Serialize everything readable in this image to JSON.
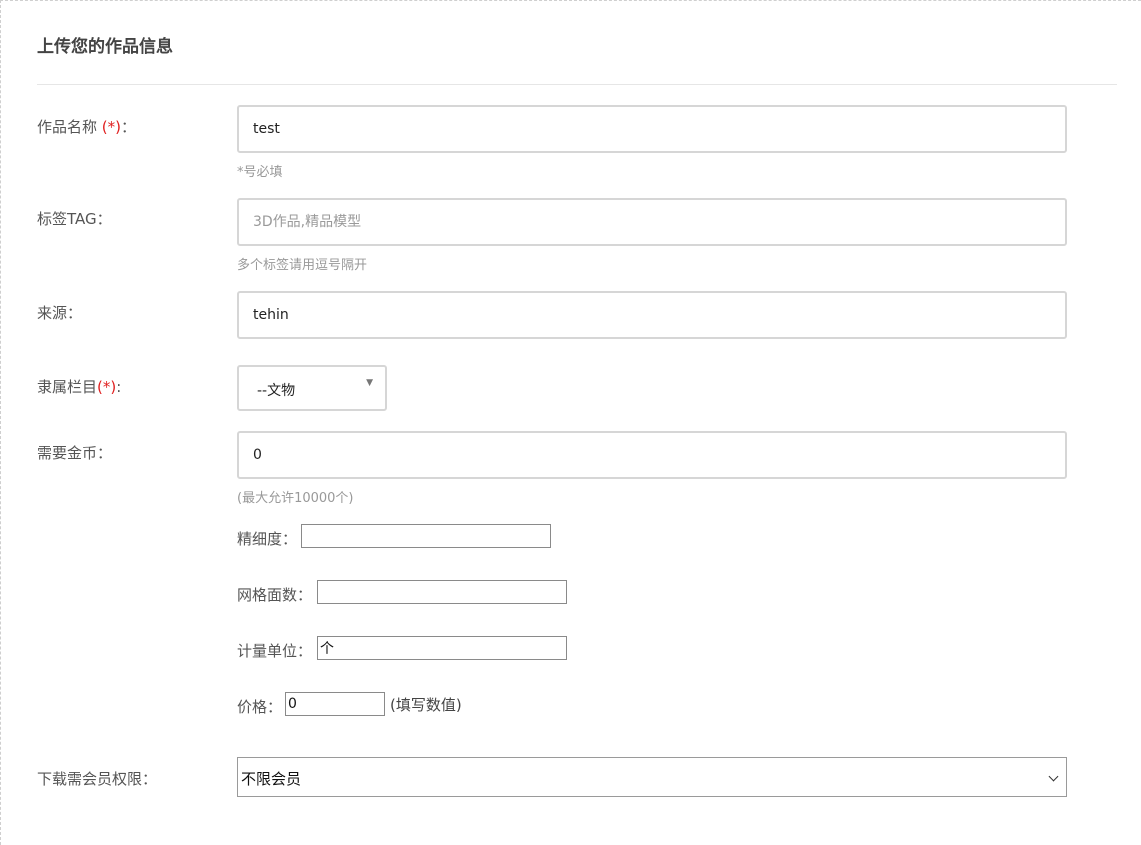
{
  "header": {
    "title": "上传您的作品信息"
  },
  "form": {
    "name": {
      "label": "作品名称 ",
      "required_mark": "(*)",
      "colon": "：",
      "value": "test",
      "hint": "*号必填"
    },
    "tag": {
      "label": "标签TAG：",
      "placeholder": "3D作品,精品模型",
      "value": "",
      "hint": "多个标签请用逗号隔开"
    },
    "source": {
      "label": "来源：",
      "value": "tehin"
    },
    "column": {
      "label": "隶属栏目",
      "required_mark": "(*)",
      "colon": ":",
      "selected": "--文物"
    },
    "coins": {
      "label": "需要金币：",
      "value": "0",
      "hint": "(最大允许10000个)"
    },
    "precision": {
      "label": "精细度：",
      "value": ""
    },
    "mesh_faces": {
      "label": "网格面数：",
      "value": ""
    },
    "unit": {
      "label": "计量单位：",
      "value": "个"
    },
    "price": {
      "label": "价格：",
      "value": "0",
      "note": "(填写数值)"
    },
    "membership": {
      "label": "下载需会员权限：",
      "selected": "不限会员"
    }
  },
  "colors": {
    "required": "#e02020",
    "border": "#d6d6d6",
    "label": "#555555",
    "hint": "#999999"
  },
  "icons": {
    "select_caret": "caret-down-icon",
    "dropdown_chevron": "chevron-down-icon"
  }
}
